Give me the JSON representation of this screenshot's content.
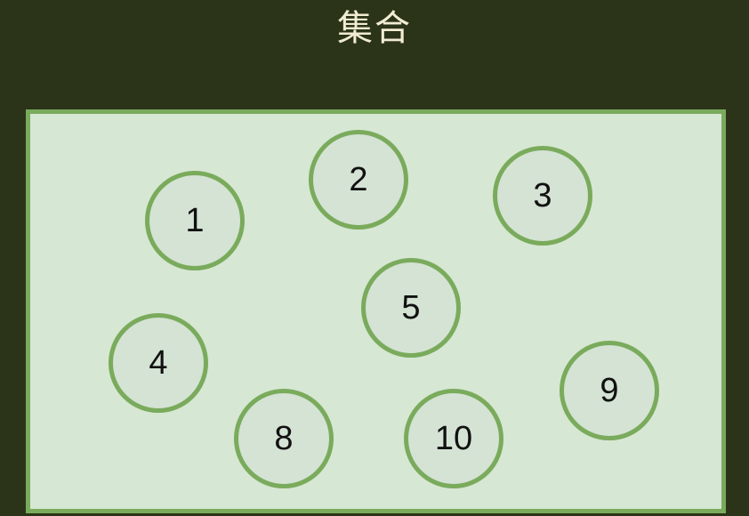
{
  "title": "集合",
  "elements": [
    {
      "id": "1",
      "label": "1"
    },
    {
      "id": "2",
      "label": "2"
    },
    {
      "id": "3",
      "label": "3"
    },
    {
      "id": "4",
      "label": "4"
    },
    {
      "id": "5",
      "label": "5"
    },
    {
      "id": "8",
      "label": "8"
    },
    {
      "id": "9",
      "label": "9"
    },
    {
      "id": "10",
      "label": "10"
    }
  ],
  "colors": {
    "background": "#2b3419",
    "set_fill": "#d6e7d3",
    "set_border": "#7aab5c",
    "circle_border": "#7aab5c",
    "title_text": "#f1ecd2",
    "number_text": "#111111"
  }
}
